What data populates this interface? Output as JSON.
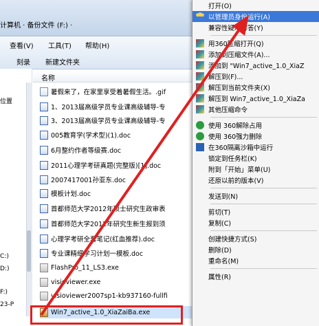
{
  "window": {
    "address": "计算机 · 备份文件 (F:) ·",
    "toolbar_row1": [
      "查看(V)",
      "工具(T)",
      "帮助(H)"
    ],
    "toolbar_row2": [
      "刻录",
      "新建文件夹"
    ],
    "column_name": "名称"
  },
  "nav": {
    "items": [
      "位置",
      "C:)",
      "D:)",
      "F:)",
      "23-P"
    ]
  },
  "files": [
    {
      "icon": "image-icon",
      "name": "暑假来了，在家里享受着暑假生活。.gif"
    },
    {
      "icon": "doc-icon",
      "name": "1、2013届高级学员专业课高级辅导-专"
    },
    {
      "icon": "doc-icon",
      "name": "3、2013届高级学员专业课高级辅导-专"
    },
    {
      "icon": "doc-icon",
      "name": "005教育学(学术型)(1).doc"
    },
    {
      "icon": "doc-icon",
      "name": "6月整约作者等级赛.doc"
    },
    {
      "icon": "doc-icon",
      "name": "2011心理学考研真题(完整版)[1].doc"
    },
    {
      "icon": "doc-icon",
      "name": "2007417001孙亚东.doc"
    },
    {
      "icon": "doc-icon",
      "name": "模板计划.doc"
    },
    {
      "icon": "doc-icon",
      "name": "首都师范大学2012年硕士研究生政审表"
    },
    {
      "icon": "doc-icon",
      "name": "首都师范大学2012年研究生新生报到须"
    },
    {
      "icon": "doc-icon",
      "name": "心理学考研全套笔记(红血推荐).doc"
    },
    {
      "icon": "doc-icon",
      "name": "专业课精细学习计划一模板.doc"
    },
    {
      "icon": "exe-icon",
      "name": "FlashPro_11_LS3.exe"
    },
    {
      "icon": "exe-icon",
      "name": "visioviewer.exe"
    },
    {
      "icon": "exe-icon",
      "name": "visioviewer2007sp1-kb937160-fullfi"
    },
    {
      "icon": "rar-icon",
      "name": "Win7_active_1.0_XiaZaiBa.exe"
    }
  ],
  "menu": {
    "items": [
      {
        "label": "打开(O)",
        "icon": "",
        "highlight": false
      },
      {
        "label": "以管理员身份运行(A)",
        "icon": "shield-icon",
        "highlight": true
      },
      {
        "label": "兼容性疑难解答(Y)",
        "icon": "",
        "highlight": false
      },
      {
        "sep": true
      },
      {
        "label": "用360压缩打开(Q)",
        "icon": "rar-icon",
        "highlight": false
      },
      {
        "label": "添加到压缩文件(A)...",
        "icon": "rar-icon",
        "highlight": false
      },
      {
        "label": "添加到 \"Win7_active_1.0_XiaZ",
        "icon": "rar-icon",
        "highlight": false
      },
      {
        "label": "解压到(F)...",
        "icon": "rar-icon",
        "highlight": false
      },
      {
        "label": "解压到当前文件夹(X)",
        "icon": "rar-icon",
        "highlight": false
      },
      {
        "label": "解压到 Win7_active_1.0_XiaZa",
        "icon": "rar-icon",
        "highlight": false
      },
      {
        "label": "其他压缩命令",
        "icon": "rar-icon",
        "highlight": false
      },
      {
        "sep": true
      },
      {
        "label": "使用 360解除占用",
        "icon": "q360-icon",
        "highlight": false
      },
      {
        "label": "使用 360强力删除",
        "icon": "q360-icon",
        "highlight": false
      },
      {
        "label": "在360隔离沙箱中运行",
        "icon": "box-icon",
        "highlight": false
      },
      {
        "label": "锁定到任务栏(K)",
        "icon": "",
        "highlight": false
      },
      {
        "label": "附到「开始」菜单(U)",
        "icon": "",
        "highlight": false
      },
      {
        "label": "还原以前的版本(V)",
        "icon": "",
        "highlight": false
      },
      {
        "sep": true
      },
      {
        "label": "发送到(N)",
        "icon": "",
        "highlight": false
      },
      {
        "sep": true
      },
      {
        "label": "剪切(T)",
        "icon": "",
        "highlight": false
      },
      {
        "label": "复制(C)",
        "icon": "",
        "highlight": false
      },
      {
        "sep": true
      },
      {
        "label": "创建快捷方式(S)",
        "icon": "",
        "highlight": false
      },
      {
        "label": "删除(D)",
        "icon": "",
        "highlight": false
      },
      {
        "label": "重命名(M)",
        "icon": "",
        "highlight": false
      },
      {
        "sep": true
      },
      {
        "label": "属性(R)",
        "icon": "",
        "highlight": false
      }
    ]
  },
  "colors": {
    "highlight_box": "#e02020",
    "menu_highlight": "#3b78d8"
  }
}
